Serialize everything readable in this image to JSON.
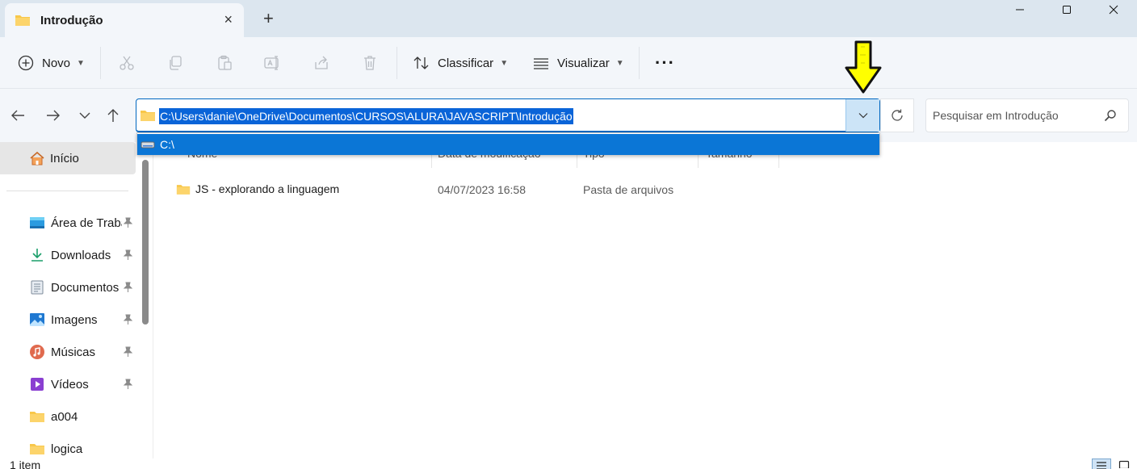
{
  "tab": {
    "title": "Introdução",
    "close_icon": "×",
    "new_icon": "+"
  },
  "window": {
    "min": "—",
    "max": "☐",
    "close": "✕"
  },
  "command_bar": {
    "new_label": "Novo",
    "sort_label": "Classificar",
    "view_label": "Visualizar",
    "more_label": "···"
  },
  "address": {
    "path": "C:\\Users\\danie\\OneDrive\\Documentos\\CURSOS\\ALURA\\JAVASCRIPT\\Introdução",
    "suggestion": "C:\\"
  },
  "search": {
    "placeholder": "Pesquisar em Introdução"
  },
  "sidebar": {
    "home": "Início",
    "items": [
      {
        "label": "Área de Trabalho",
        "icon": "desktop-icon",
        "pinned": true
      },
      {
        "label": "Downloads",
        "icon": "download-icon",
        "pinned": true
      },
      {
        "label": "Documentos",
        "icon": "documents-icon",
        "pinned": true
      },
      {
        "label": "Imagens",
        "icon": "pictures-icon",
        "pinned": true
      },
      {
        "label": "Músicas",
        "icon": "music-icon",
        "pinned": true
      },
      {
        "label": "Vídeos",
        "icon": "videos-icon",
        "pinned": true
      },
      {
        "label": "a004",
        "icon": "folder-icon",
        "pinned": false
      },
      {
        "label": "logica",
        "icon": "folder-icon",
        "pinned": false
      }
    ]
  },
  "columns": {
    "name": "Nome",
    "modified": "Data de modificação",
    "type": "Tipo",
    "size": "Tamanho"
  },
  "files": [
    {
      "name": "JS - explorando a linguagem",
      "modified": "04/07/2023 16:58",
      "type": "Pasta de arquivos"
    }
  ],
  "status": {
    "count": "1 item"
  },
  "colors": {
    "accent": "#0067c0",
    "selection": "#0a64d8",
    "annotation_arrow": "#ffff00"
  }
}
